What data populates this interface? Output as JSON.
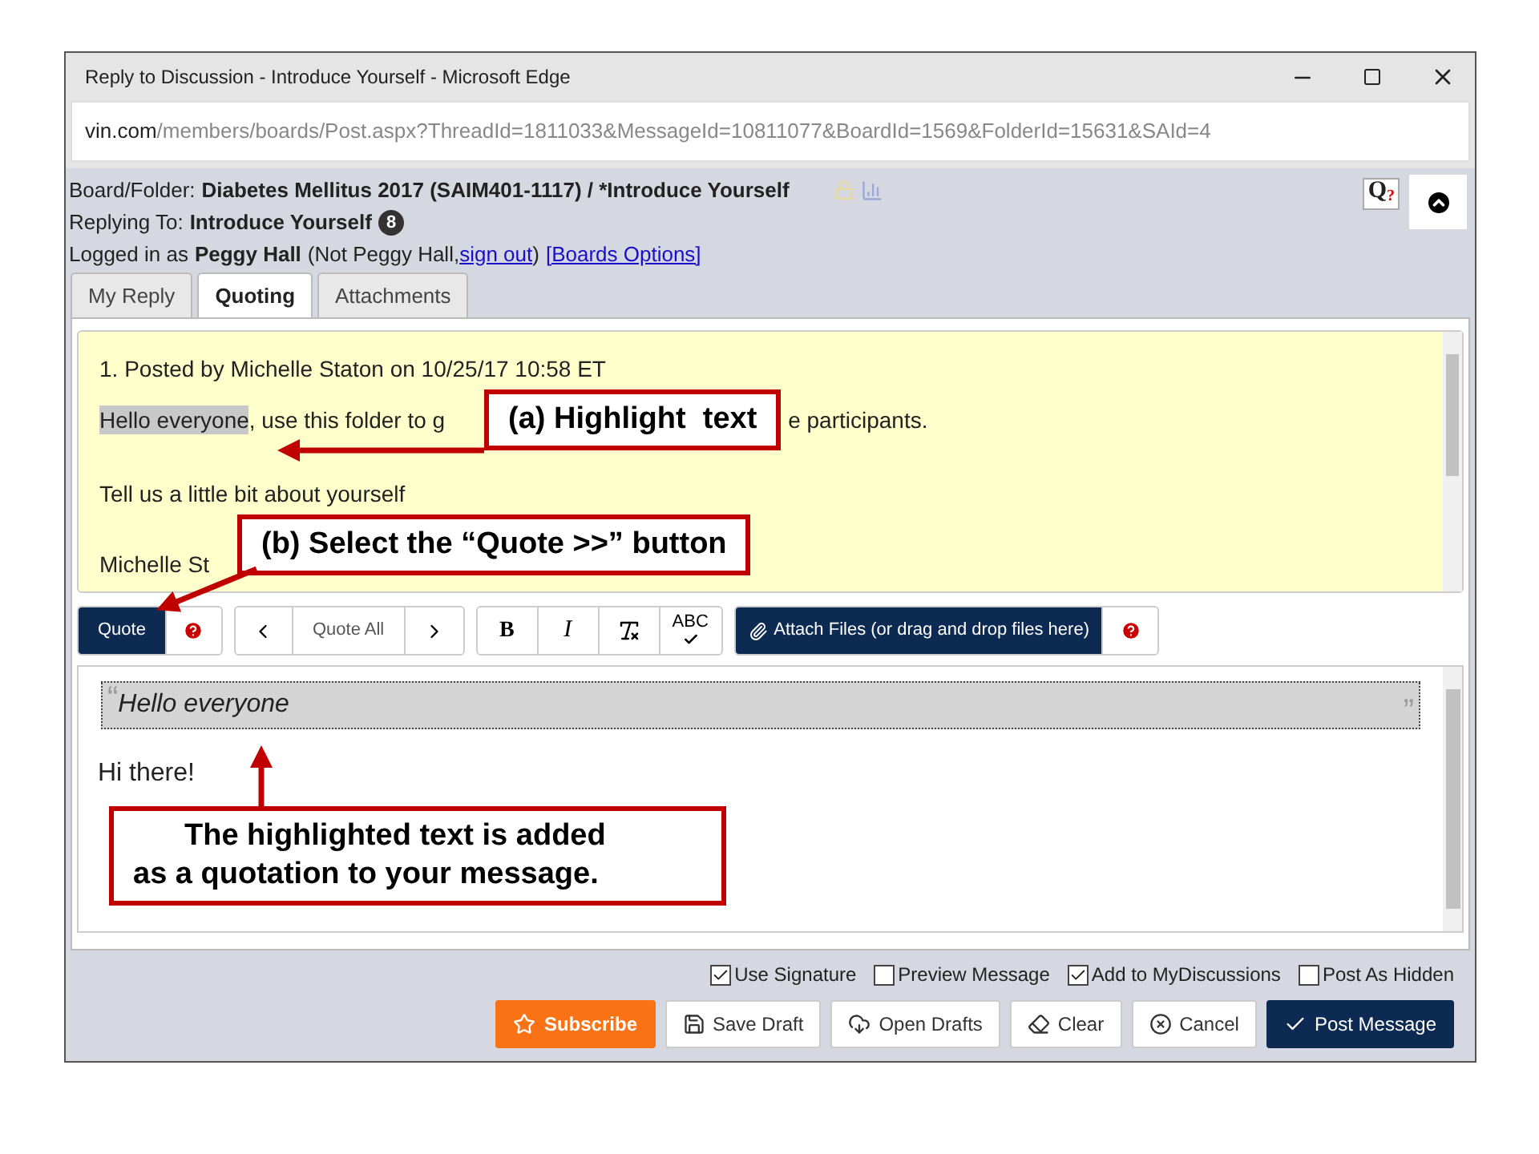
{
  "window": {
    "title": "Reply to Discussion - Introduce Yourself - Microsoft Edge"
  },
  "address_bar": {
    "domain": "vin.com",
    "path": "/members/boards/Post.aspx?ThreadId=1811033&MessageId=10811077&BoardId=1569&FolderId=15631&SAId=4"
  },
  "header": {
    "board_label": "Board/Folder:",
    "board_value": "Diabetes Mellitus 2017 (SAIM401-1117) / *Introduce Yourself",
    "replying_label": "Replying To:",
    "replying_value": "Introduce Yourself",
    "reply_count": "8",
    "logged_label": "Logged in as",
    "user": "Peggy Hall",
    "not_user": "(Not Peggy Hall,",
    "sign_out": "sign out",
    "close_paren": ")",
    "boards_options": "[Boards Options]",
    "help_letter": "Q",
    "help_mark": "?"
  },
  "tabs": [
    {
      "label": "My Reply",
      "selected": false
    },
    {
      "label": "Quoting",
      "selected": true
    },
    {
      "label": "Attachments",
      "selected": false
    }
  ],
  "quoted_post": {
    "header": "1. Posted by Michelle Staton on 10/25/17 10:58 ET",
    "highlighted": "Hello everyone",
    "text_before": ", use this folder to g",
    "text_after": "e participants.",
    "line_2": "Tell us a little bit about yourself",
    "line_3": "Michelle St"
  },
  "toolbar": [
    [
      {
        "kind": "dark",
        "label": "Quote"
      },
      {
        "kind": "help"
      }
    ],
    [
      {
        "kind": "prev"
      },
      {
        "kind": "text",
        "label": "Quote All"
      },
      {
        "kind": "next"
      }
    ],
    [
      {
        "kind": "bold",
        "label": "B"
      },
      {
        "kind": "italic",
        "label": "I"
      },
      {
        "kind": "clear_format"
      },
      {
        "kind": "spellcheck",
        "label": "ABC"
      }
    ],
    [
      {
        "kind": "attach",
        "label": "Attach Files (or drag and drop files here)"
      },
      {
        "kind": "help"
      }
    ]
  ],
  "editor": {
    "open_mark": "“",
    "quote": "Hello everyone",
    "close_mark": "”",
    "body": "Hi there!"
  },
  "options": [
    {
      "label": "Use Signature",
      "checked": true
    },
    {
      "label": "Preview Message",
      "checked": false
    },
    {
      "label": "Add to MyDiscussions",
      "checked": true
    },
    {
      "label": "Post As Hidden",
      "checked": false
    }
  ],
  "actions": [
    {
      "kind": "subscribe",
      "label": "Subscribe"
    },
    {
      "kind": "save",
      "label": "Save Draft"
    },
    {
      "kind": "open",
      "label": "Open Drafts"
    },
    {
      "kind": "clear",
      "label": "Clear"
    },
    {
      "kind": "cancel",
      "label": "Cancel"
    },
    {
      "kind": "post",
      "label": "Post Message"
    }
  ],
  "callouts": [
    {
      "lines": [
        "(a) Highlight  text"
      ]
    },
    {
      "lines": [
        "(b) Select the “Quote >>” button"
      ]
    },
    {
      "lines": [
        "The highlighted text is added",
        "as a quotation to your message."
      ]
    }
  ]
}
